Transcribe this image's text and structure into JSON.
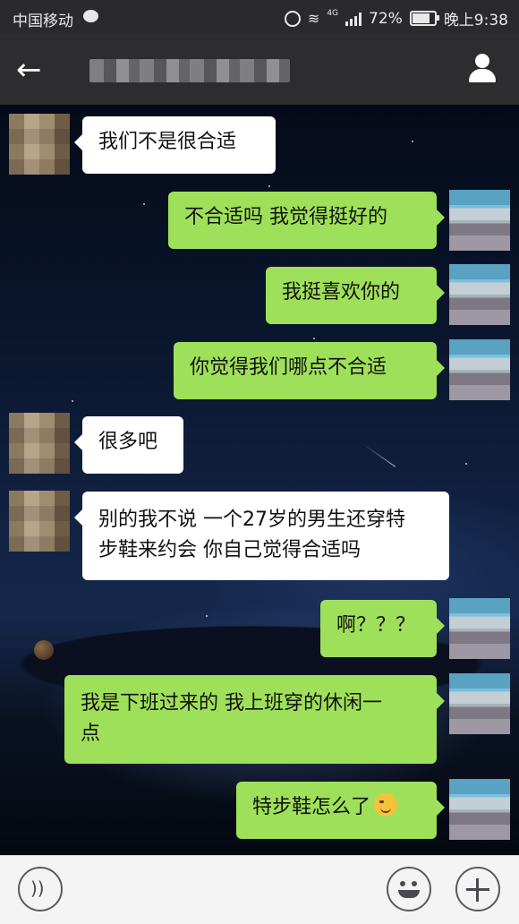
{
  "status_bar": {
    "carrier": "中国移动",
    "network": "4G",
    "battery": "72%",
    "battery_level": 0.72,
    "time": "晚上9:38"
  },
  "header": {
    "back_icon": "arrow-left-icon",
    "profile_icon": "person-icon"
  },
  "messages": [
    {
      "side": "them",
      "lines": [
        "我们不是很合适"
      ]
    },
    {
      "side": "me",
      "lines": [
        "不合适吗 我觉得挺好的"
      ]
    },
    {
      "side": "me",
      "lines": [
        "我挺喜欢你的"
      ]
    },
    {
      "side": "me",
      "lines": [
        "你觉得我们哪点不合适"
      ]
    },
    {
      "side": "them",
      "lines": [
        "很多吧"
      ]
    },
    {
      "side": "them",
      "lines": [
        "别的我不说 一个27岁的男生还穿特",
        "步鞋来约会 你自己觉得合适吗"
      ]
    },
    {
      "side": "me",
      "lines": [
        "啊？？？"
      ]
    },
    {
      "side": "me",
      "lines": [
        "我是下班过来的 我上班穿的休闲一",
        "点"
      ]
    },
    {
      "side": "me",
      "lines": [
        "特步鞋怎么了"
      ],
      "emoji": "smirk-emoji-icon"
    }
  ],
  "input_bar": {
    "voice_icon": "voice-icon",
    "emoji_icon": "smiley-icon",
    "plus_icon": "plus-icon"
  }
}
